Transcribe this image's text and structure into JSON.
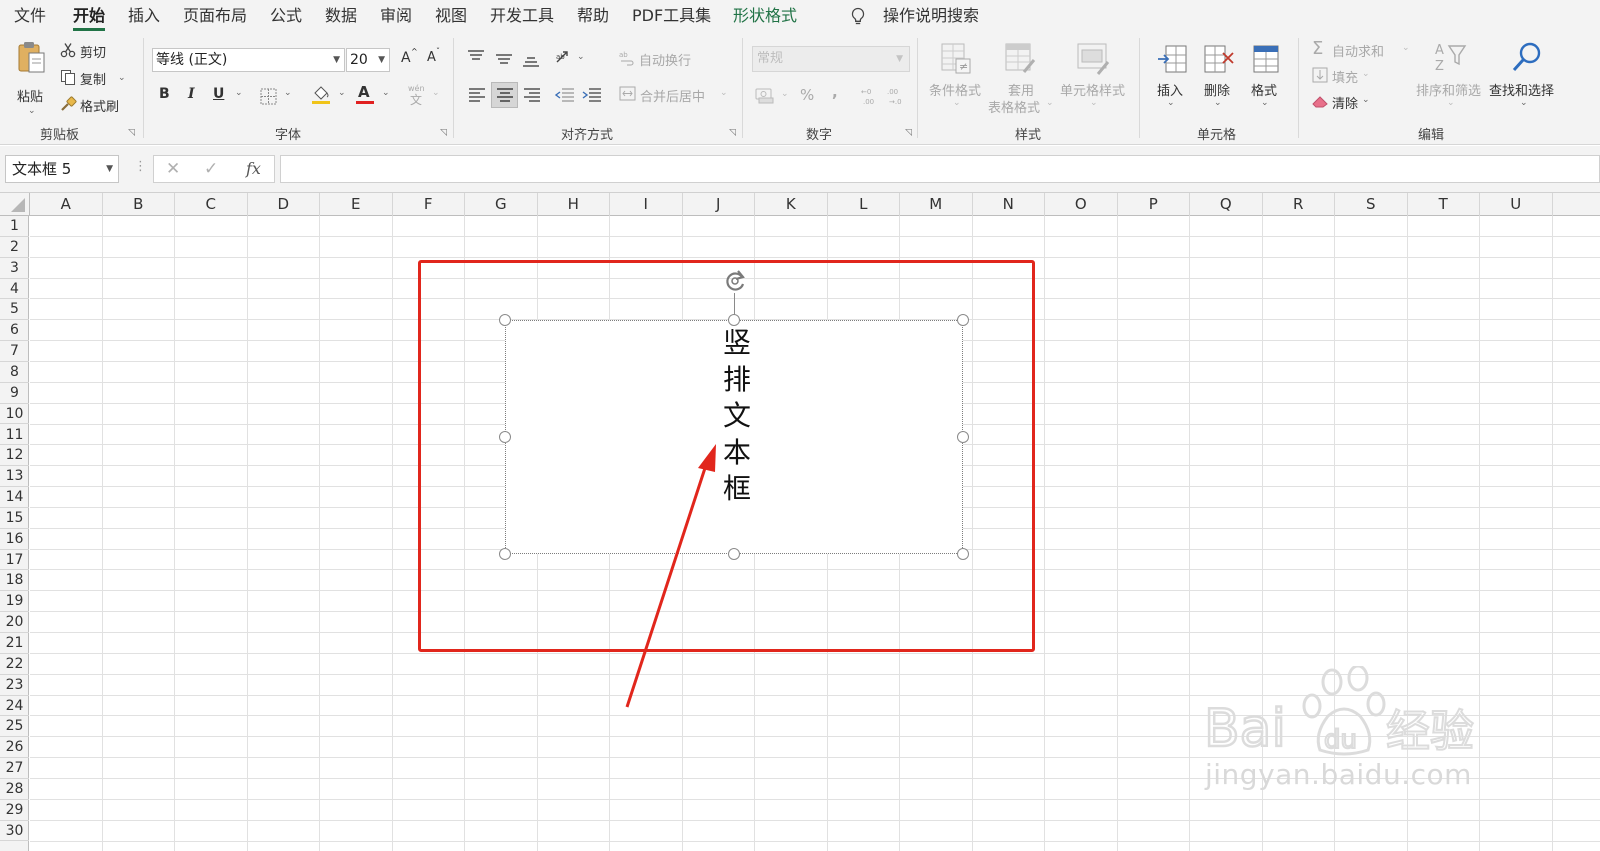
{
  "menu": {
    "tabs": [
      {
        "label": "文件",
        "active": false
      },
      {
        "label": "开始",
        "active": true
      },
      {
        "label": "插入",
        "active": false
      },
      {
        "label": "页面布局",
        "active": false
      },
      {
        "label": "公式",
        "active": false
      },
      {
        "label": "数据",
        "active": false
      },
      {
        "label": "审阅",
        "active": false
      },
      {
        "label": "视图",
        "active": false
      },
      {
        "label": "开发工具",
        "active": false
      },
      {
        "label": "帮助",
        "active": false
      },
      {
        "label": "PDF工具集",
        "active": false
      },
      {
        "label": "形状格式",
        "active": false,
        "contextual": true
      }
    ],
    "tell_me": "操作说明搜索"
  },
  "ribbon": {
    "clipboard": {
      "group_label": "剪贴板",
      "paste": "粘贴",
      "cut": "剪切",
      "copy": "复制",
      "format_painter": "格式刷"
    },
    "font": {
      "group_label": "字体",
      "font_name": "等线 (正文)",
      "font_size": "20",
      "bold": "B",
      "italic": "I",
      "underline": "U",
      "increase_size": "A",
      "decrease_size": "A",
      "font_color": "A",
      "phonetic": "wén"
    },
    "alignment": {
      "group_label": "对齐方式",
      "wrap_text": "自动换行",
      "merge_center": "合并后居中"
    },
    "number": {
      "group_label": "数字",
      "format": "常规",
      "percent": "%",
      "comma": ","
    },
    "styles": {
      "group_label": "样式",
      "conditional": "条件格式",
      "table_format_line1": "套用",
      "table_format_line2": "表格格式",
      "cell_styles": "单元格样式"
    },
    "cells": {
      "group_label": "单元格",
      "insert": "插入",
      "delete": "删除",
      "format": "格式"
    },
    "editing": {
      "group_label": "编辑",
      "autosum": "自动求和",
      "fill": "填充",
      "clear": "清除",
      "sort_filter": "排序和筛选",
      "find_select": "查找和选择"
    }
  },
  "formula_bar": {
    "name_box": "文本框 5",
    "cancel": "✕",
    "enter": "✓",
    "fx": "fx",
    "content": ""
  },
  "sheet": {
    "columns": [
      "A",
      "B",
      "C",
      "D",
      "E",
      "F",
      "G",
      "H",
      "I",
      "J",
      "K",
      "L",
      "M",
      "N",
      "O",
      "P",
      "Q",
      "R",
      "S",
      "T",
      "U"
    ],
    "rows": [
      "1",
      "2",
      "3",
      "4",
      "5",
      "6",
      "7",
      "8",
      "9",
      "10",
      "11",
      "12",
      "13",
      "14",
      "15",
      "16",
      "17",
      "18",
      "19",
      "20",
      "21",
      "22",
      "23",
      "24",
      "25",
      "26",
      "27",
      "28",
      "29",
      "30"
    ]
  },
  "textbox": {
    "text": "竖排文本框"
  },
  "watermark": {
    "brand": "Baidu经验",
    "url": "jingyan.baidu.com"
  },
  "colors": {
    "accent": "#217346",
    "annotation": "#e1261c",
    "ribbon_bg": "#f3f3f3",
    "gridline": "#e1e1e1"
  }
}
